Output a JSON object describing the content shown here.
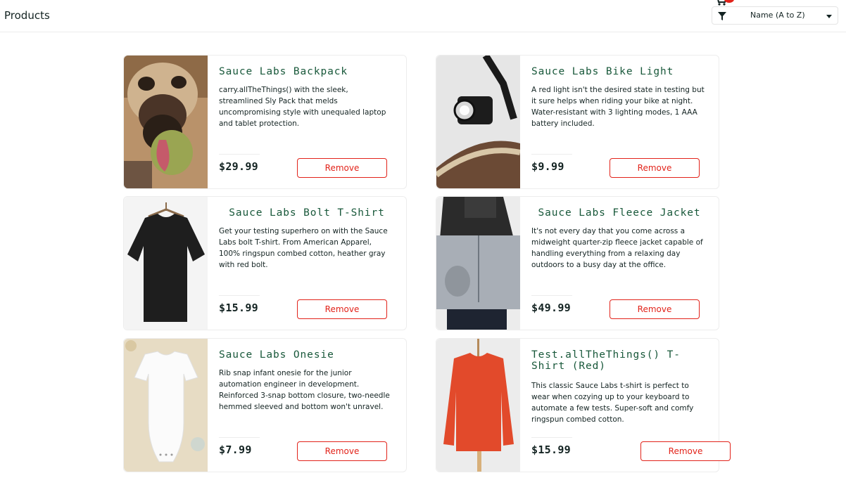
{
  "header": {
    "title": "Products",
    "sort_label": "Name (A to Z)"
  },
  "colors": {
    "product_name": "#18583a",
    "remove_button": "#e2231a",
    "text": "#132322"
  },
  "icons": [
    "shopping-cart-icon",
    "cart-badge-icon",
    "funnel-icon",
    "chevron-down-icon"
  ],
  "products": [
    {
      "name": "Sauce Labs Backpack",
      "description": "carry.allTheThings() with the sleek, streamlined Sly Pack that melds uncompromising style with unequaled laptop and tablet protection.",
      "price": "$29.99",
      "button": "Remove"
    },
    {
      "name": "Sauce Labs Bike Light",
      "description": "A red light isn't the desired state in testing but it sure helps when riding your bike at night. Water-resistant with 3 lighting modes, 1 AAA battery included.",
      "price": "$9.99",
      "button": "Remove"
    },
    {
      "name": "Sauce Labs Bolt T-Shirt",
      "description": "Get your testing superhero on with the Sauce Labs bolt T-shirt. From American Apparel, 100% ringspun combed cotton, heather gray with red bolt.",
      "price": "$15.99",
      "button": "Remove"
    },
    {
      "name": "Sauce Labs Fleece Jacket",
      "description": "It's not every day that you come across a midweight quarter-zip fleece jacket capable of handling everything from a relaxing day outdoors to a busy day at the office.",
      "price": "$49.99",
      "button": "Remove"
    },
    {
      "name": "Sauce Labs Onesie",
      "description": "Rib snap infant onesie for the junior automation engineer in development. Reinforced 3-snap bottom closure, two-needle hemmed sleeved and bottom won't unravel.",
      "price": "$7.99",
      "button": "Remove"
    },
    {
      "name": "Test.allTheThings() T-Shirt (Red)",
      "description": "This classic Sauce Labs t-shirt is perfect to wear when cozying up to your keyboard to automate a few tests. Super-soft and comfy ringspun combed cotton.",
      "price": "$15.99",
      "button": "Remove"
    }
  ]
}
